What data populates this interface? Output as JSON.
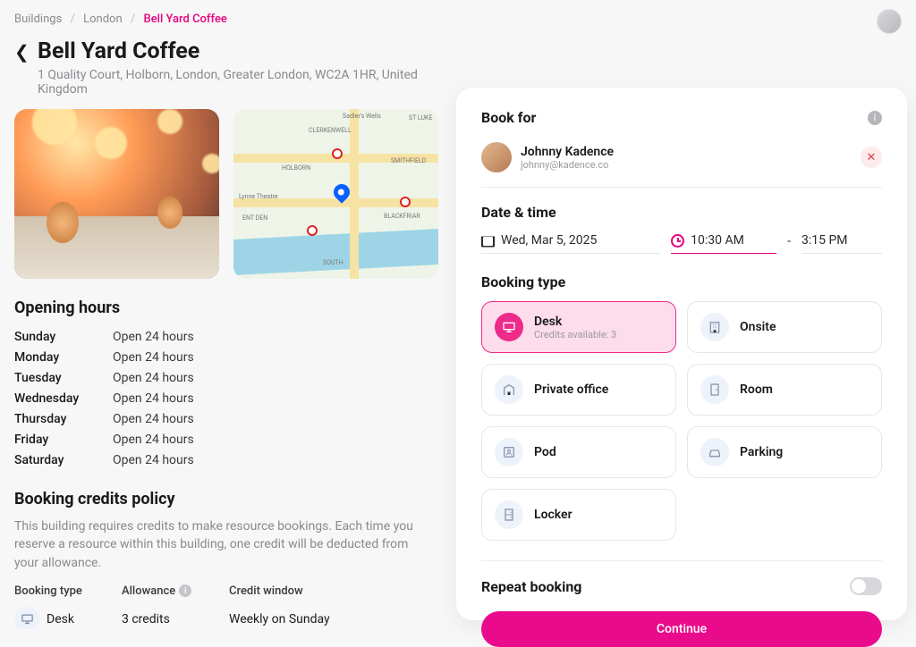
{
  "breadcrumb": {
    "root": "Buildings",
    "city": "London",
    "current": "Bell Yard Coffee"
  },
  "header": {
    "title": "Bell Yard Coffee",
    "address": "1 Quality Court, Holborn, London, Greater London, WC2A 1HR, United Kingdom"
  },
  "map_labels": {
    "a": "CLERKENWELL",
    "b": "HOLBORN",
    "c": "SMITHFIELD",
    "d": "Sadler's Wells",
    "e": "ST LUKE",
    "f": "Lynne Theatre",
    "g": "ENT DEN",
    "h": "BLACKFRIAR",
    "i": "SOUTH"
  },
  "hours": {
    "title": "Opening hours",
    "rows": [
      {
        "day": "Sunday",
        "val": "Open 24 hours"
      },
      {
        "day": "Monday",
        "val": "Open 24 hours"
      },
      {
        "day": "Tuesday",
        "val": "Open 24 hours"
      },
      {
        "day": "Wednesday",
        "val": "Open 24 hours"
      },
      {
        "day": "Thursday",
        "val": "Open 24 hours"
      },
      {
        "day": "Friday",
        "val": "Open 24 hours"
      },
      {
        "day": "Saturday",
        "val": "Open 24 hours"
      }
    ]
  },
  "policy": {
    "title": "Booking credits policy",
    "text": "This building requires credits to make resource bookings. Each time you reserve a resource within this building, one credit will be deducted from your allowance.",
    "head": {
      "c1": "Booking type",
      "c2": "Allowance",
      "c3": "Credit window"
    },
    "row": {
      "c1": "Desk",
      "c2": "3 credits",
      "c3": "Weekly on Sunday"
    }
  },
  "panel": {
    "bookfor": "Book for",
    "user": {
      "name": "Johnny Kadence",
      "email": "johnny@kadence.co"
    },
    "datetime": {
      "title": "Date & time",
      "date": "Wed, Mar 5, 2025",
      "start": "10:30 AM",
      "sep": "-",
      "end": "3:15 PM"
    },
    "booking_type": {
      "title": "Booking type",
      "options": {
        "desk": {
          "label": "Desk",
          "sub": "Credits available: 3"
        },
        "onsite": {
          "label": "Onsite"
        },
        "private_office": {
          "label": "Private office"
        },
        "room": {
          "label": "Room"
        },
        "pod": {
          "label": "Pod"
        },
        "parking": {
          "label": "Parking"
        },
        "locker": {
          "label": "Locker"
        }
      }
    },
    "repeat": "Repeat booking",
    "continue": "Continue"
  }
}
